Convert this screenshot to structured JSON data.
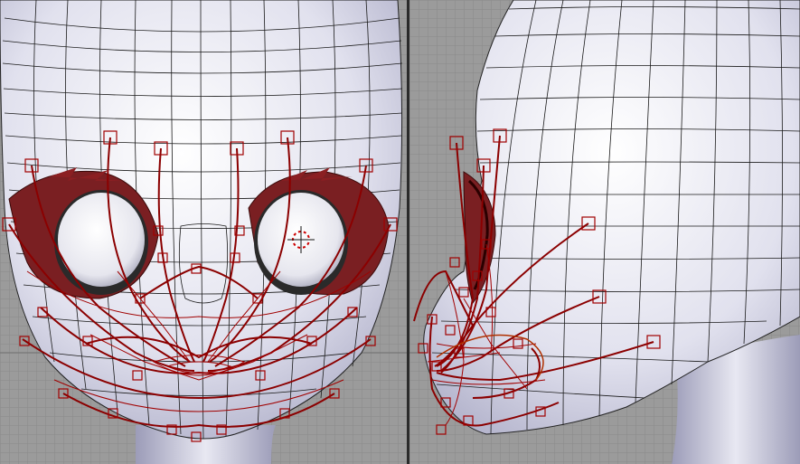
{
  "app": {
    "title": ""
  },
  "viewports": [
    {
      "name": "front",
      "label": ""
    },
    {
      "name": "side",
      "label": ""
    }
  ],
  "colors": {
    "background": "#9b9b9b",
    "grid_minor": "#8a8a8a",
    "grid_major": "#7a7a7a",
    "mesh_wire": "#111111",
    "mesh_fill": "#e4e4f0",
    "rig_curve": "#8b0000",
    "rig_handle": "#a00000",
    "eye_white": "#ededf2",
    "eye_socket": "#7a1f22"
  },
  "icons": {
    "cursor": "3d-cursor-icon"
  }
}
